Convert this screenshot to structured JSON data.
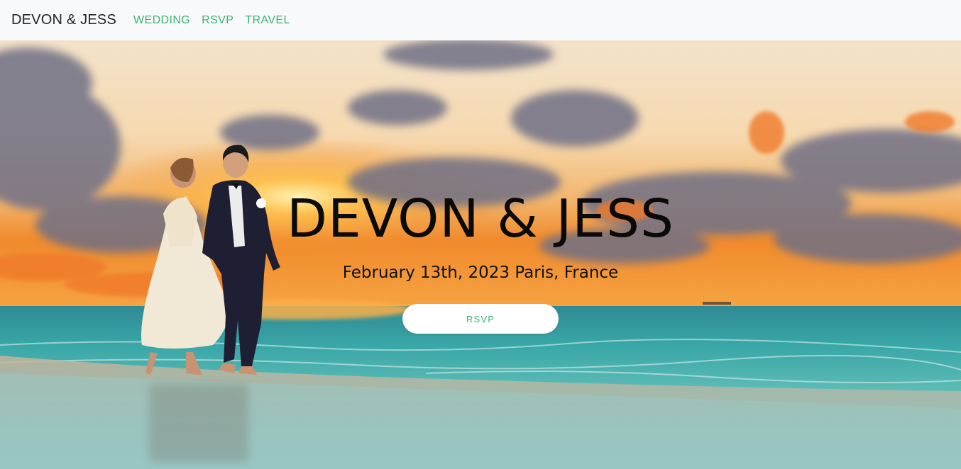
{
  "navbar": {
    "brand": "DEVON & JESS",
    "links": [
      "WEDDING",
      "RSVP",
      "TRAVEL"
    ]
  },
  "hero": {
    "title": "DEVON & JESS",
    "subtitle": "February 13th, 2023 Paris, France",
    "button_label": "RSVP",
    "image_description_icon": "beach-sunset-couple-photo"
  },
  "colors": {
    "accent": "#3cb371",
    "navbar_bg": "#f8f9fa",
    "brand_text": "#212529"
  }
}
